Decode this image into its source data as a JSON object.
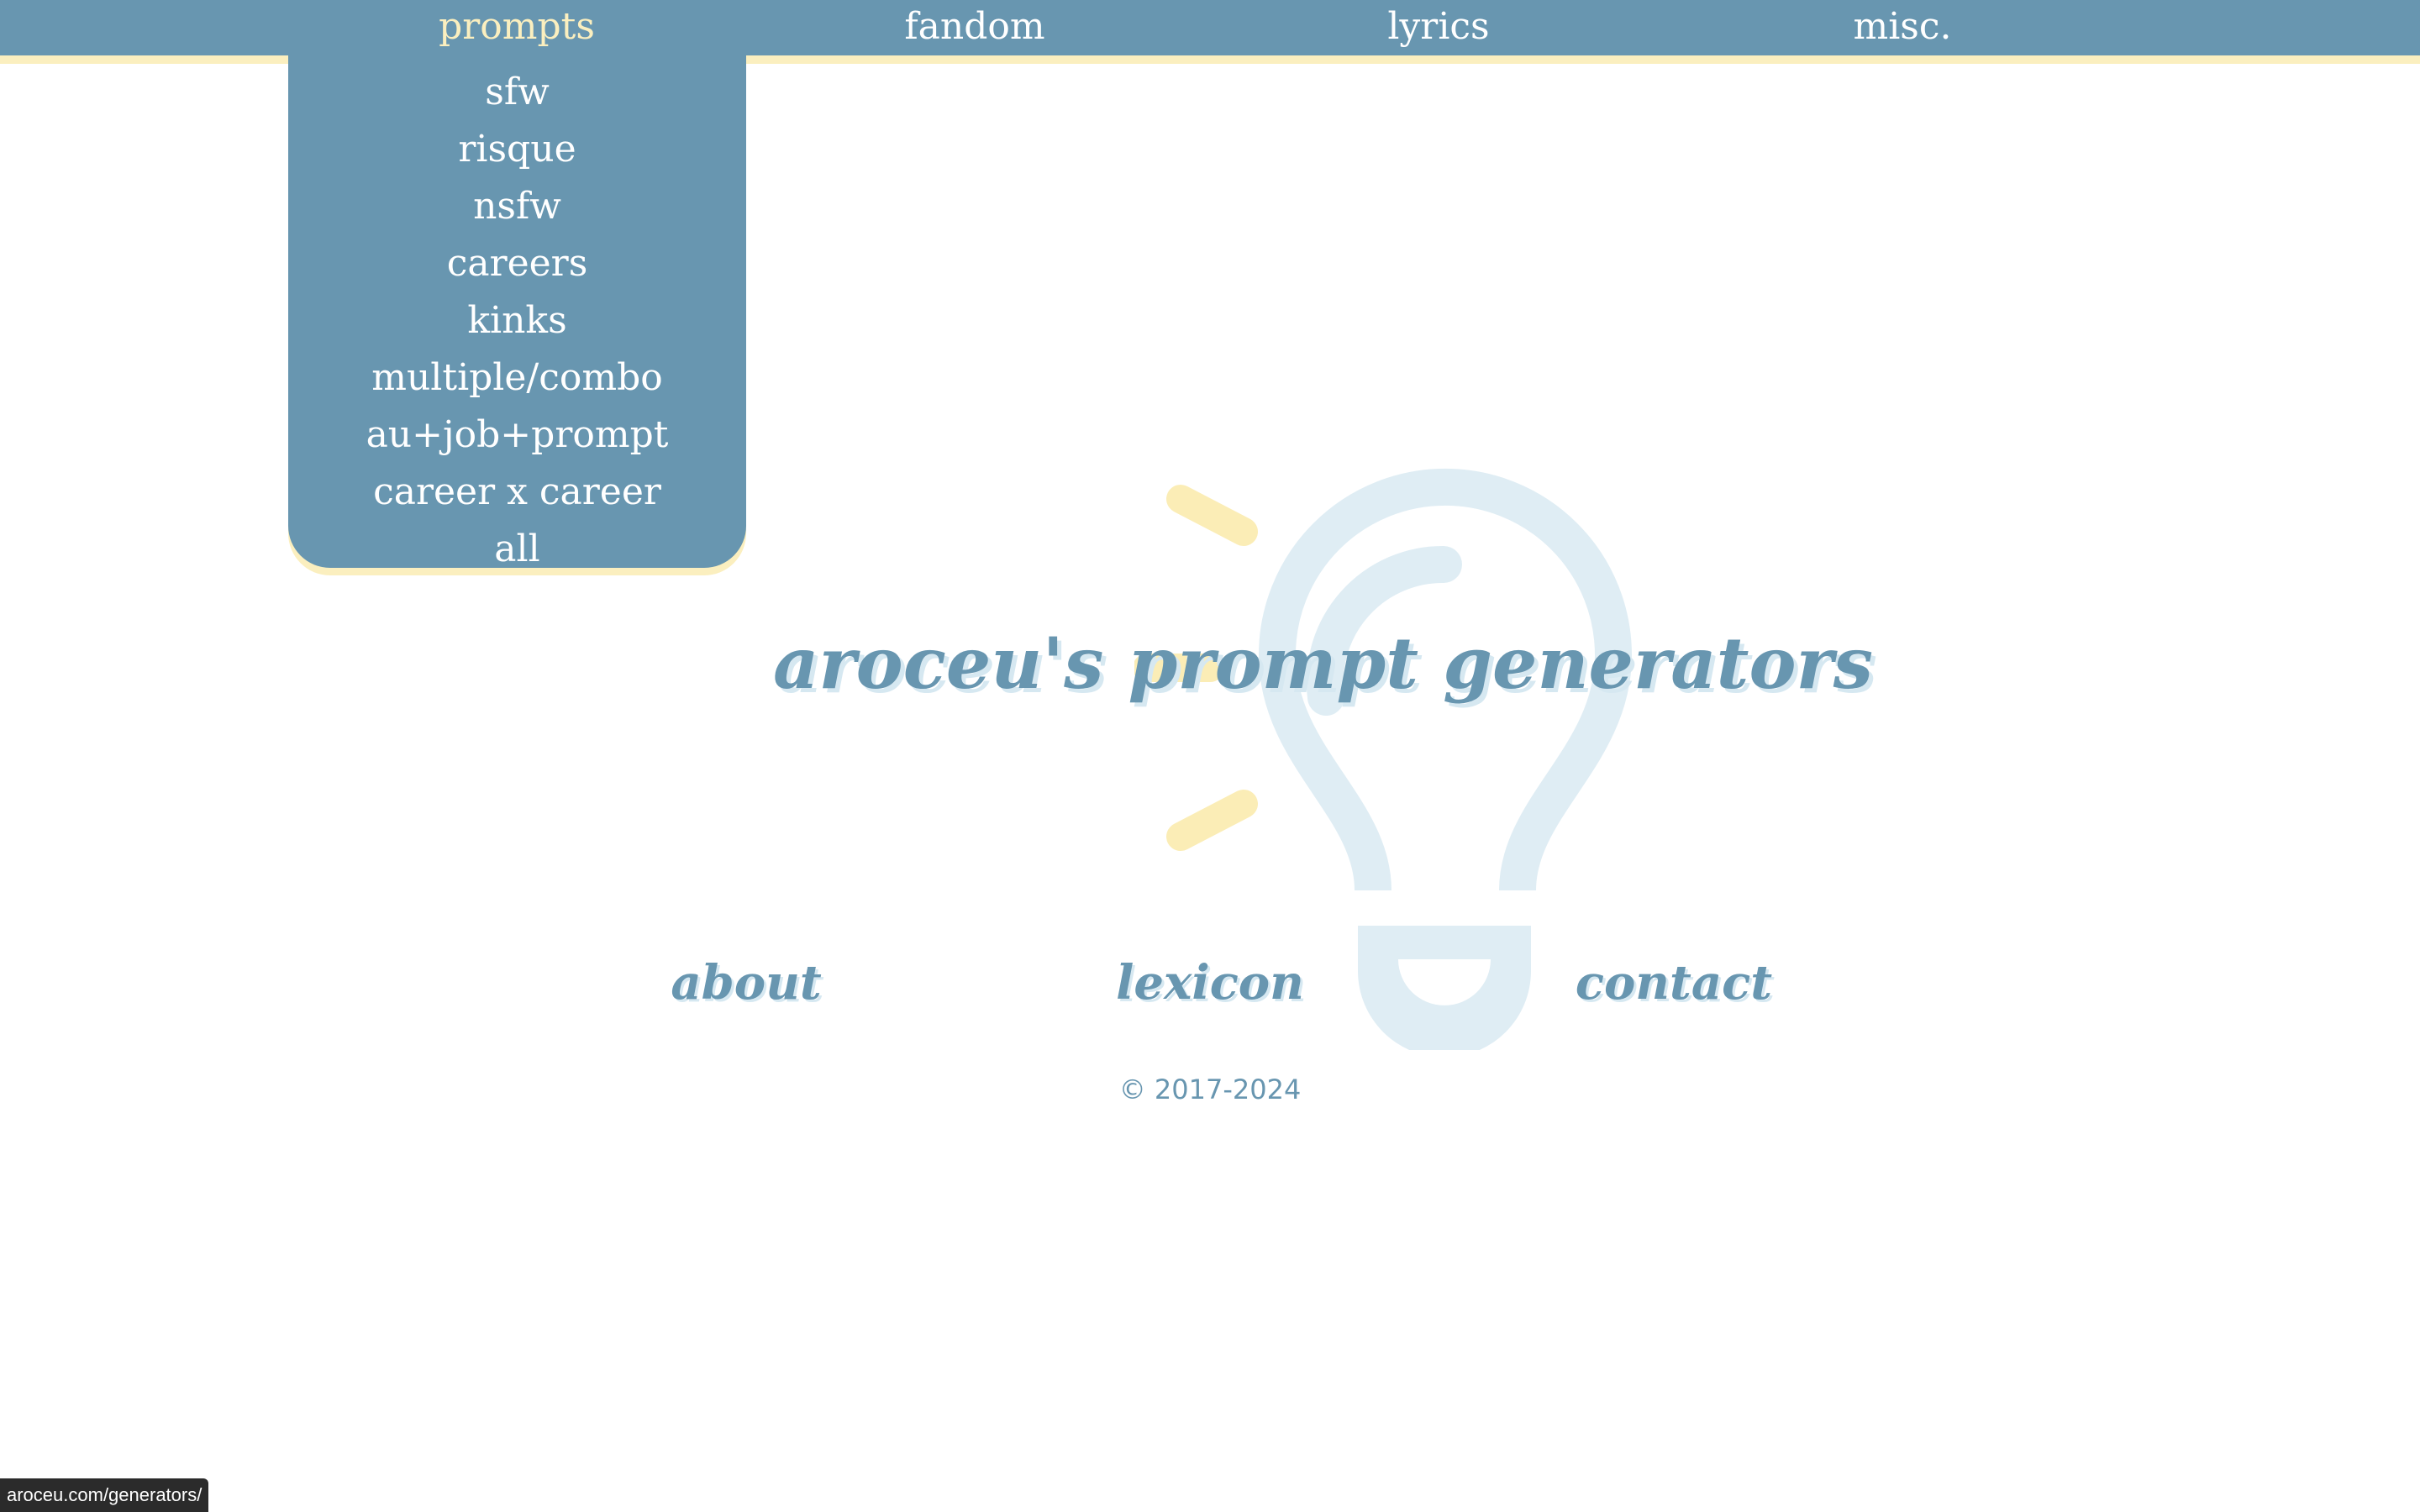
{
  "colors": {
    "nav_bg": "#6896b0",
    "accent_yellow": "#fbefbf",
    "text_white": "#ffffff",
    "title_blue": "#6896b0",
    "bulb_blue": "#dfedf4",
    "bulb_rays": "#fbedb6"
  },
  "nav": {
    "items": [
      {
        "label": "prompts",
        "active": true
      },
      {
        "label": "fandom"
      },
      {
        "label": "lyrics"
      },
      {
        "label": "misc."
      }
    ]
  },
  "dropdown": {
    "items": [
      {
        "label": "sfw"
      },
      {
        "label": "risque"
      },
      {
        "label": "nsfw"
      },
      {
        "label": "careers"
      },
      {
        "label": "kinks"
      },
      {
        "label": "multiple/combo"
      },
      {
        "label": "au+job+prompt"
      },
      {
        "label": "career x career"
      },
      {
        "label": "all"
      }
    ]
  },
  "main": {
    "title": "aroceu's prompt generators",
    "bulb_icon": "lightbulb-icon"
  },
  "footer": {
    "links": [
      {
        "label": "about"
      },
      {
        "label": "lexicon"
      },
      {
        "label": "contact"
      }
    ],
    "copyright": "© 2017-2024"
  },
  "status_bar": {
    "url": "aroceu.com/generators/"
  }
}
